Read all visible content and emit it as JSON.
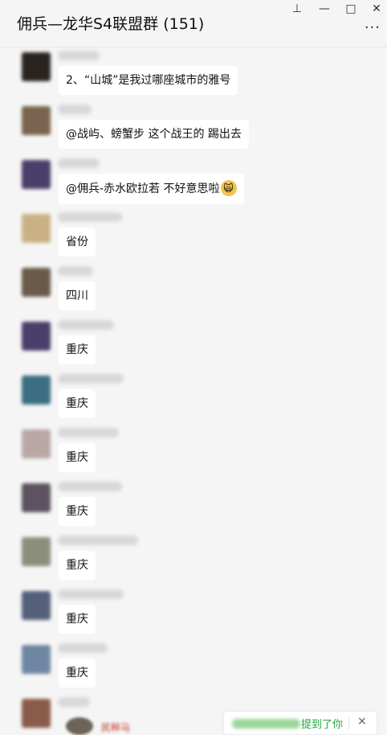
{
  "window": {
    "title": "佣兵—龙华S4联盟群 (151)",
    "pin_glyph": "⊥",
    "minimize_glyph": "—",
    "maximize_glyph": "□",
    "close_glyph": "✕",
    "more_glyph": "···"
  },
  "messages": [
    {
      "text": "2、“山城”是我过哪座城市的雅号",
      "avatar_color": "#2a2420",
      "sender_width": 52
    },
    {
      "text": "@战屿、螃蟹步 这个战王的 踢出去",
      "avatar_color": "#7a6450",
      "sender_width": 42
    },
    {
      "text": "@佣兵-赤水欧拉若 不好意思啦",
      "emoji": "🙀",
      "avatar_color": "#4a3f6b",
      "sender_width": 52
    },
    {
      "text": "省份",
      "avatar_color": "#c9b183",
      "sender_width": 80
    },
    {
      "text": "四川",
      "avatar_color": "#6b5a49",
      "sender_width": 44
    },
    {
      "text": "重庆",
      "avatar_color": "#4a3f6b",
      "sender_width": 70
    },
    {
      "text": "重庆",
      "avatar_color": "#3b6e83",
      "sender_width": 82
    },
    {
      "text": "重庆",
      "avatar_color": "#b9a7a5",
      "sender_width": 76
    },
    {
      "text": "重庆",
      "avatar_color": "#5d5260",
      "sender_width": 80
    },
    {
      "text": "重庆",
      "avatar_color": "#8a8f7a",
      "sender_width": 100
    },
    {
      "text": "重庆",
      "avatar_color": "#54607a",
      "sender_width": 82
    },
    {
      "text": "重庆",
      "avatar_color": "#6f86a3",
      "sender_width": 62
    }
  ],
  "last_message": {
    "avatar_color": "#8a5a4a",
    "sender_width": 40,
    "text": "民粹马"
  },
  "mention_toast": {
    "text": "提到了你",
    "close_glyph": "×"
  }
}
